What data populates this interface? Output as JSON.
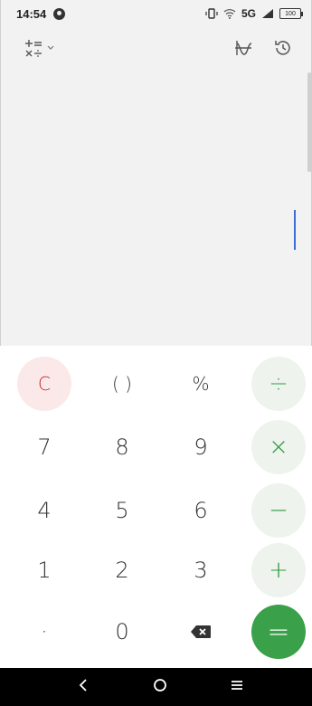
{
  "status": {
    "time": "14:54",
    "network": "5G",
    "battery": "100"
  },
  "toolbar": {
    "mode_icon": "calculator-mode-icon",
    "graph_icon": "graph-icon",
    "history_icon": "history-icon"
  },
  "keys": {
    "clear": "C",
    "parentheses": "( )",
    "percent": "%",
    "divide": "÷",
    "seven": "7",
    "eight": "8",
    "nine": "9",
    "multiply": "×",
    "four": "4",
    "five": "5",
    "six": "6",
    "minus": "−",
    "one": "1",
    "two": "2",
    "three": "3",
    "plus": "+",
    "decimal": "·",
    "zero": "0",
    "equals": "="
  },
  "colors": {
    "clear_text": "#c62828",
    "operator_text": "#2e9a3e",
    "equals_bg": "#3aa04a",
    "cursor": "#3a6fd8"
  }
}
